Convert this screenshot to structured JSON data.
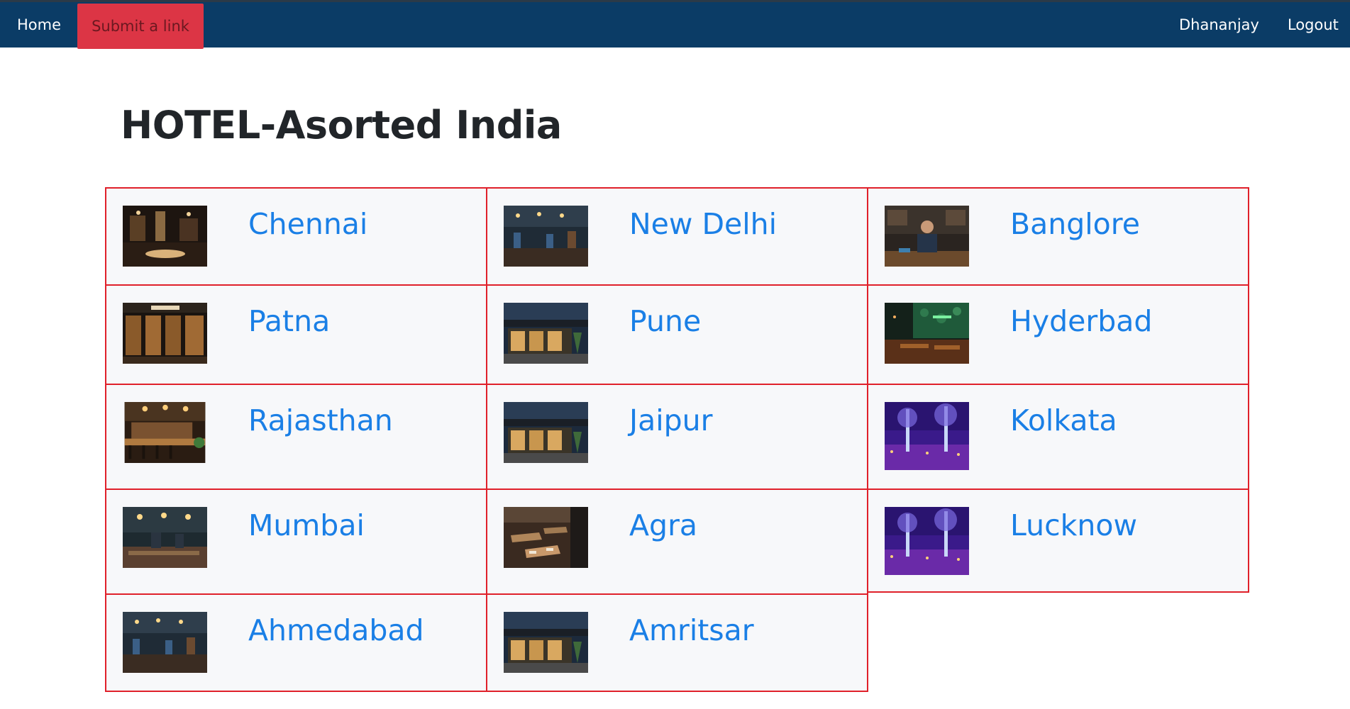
{
  "nav": {
    "home_label": "Home",
    "submit_label": "Submit a link",
    "user_label": "Dhananjay",
    "logout_label": "Logout"
  },
  "page": {
    "title": "HOTEL-Asorted India"
  },
  "colors": {
    "navbar": "#0b3c66",
    "submit_button": "#dc3545",
    "card_border": "#e0202a",
    "card_bg": "#f7f8fa",
    "link": "#1a7fe6"
  },
  "cities": [
    {
      "name": "Chennai",
      "thumb": "hotel-interior-photo"
    },
    {
      "name": "New Delhi",
      "thumb": "restaurant-photo"
    },
    {
      "name": "Banglore",
      "thumb": "chef-photo"
    },
    {
      "name": "Patna",
      "thumb": "restaurant-facade-photo"
    },
    {
      "name": "Pune",
      "thumb": "restaurant-exterior-photo"
    },
    {
      "name": "Hyderbad",
      "thumb": "green-wall-restaurant-photo"
    },
    {
      "name": "Rajasthan",
      "thumb": "bar-counter-photo"
    },
    {
      "name": "Jaipur",
      "thumb": "restaurant-exterior-photo"
    },
    {
      "name": "Kolkata",
      "thumb": "purple-lit-trees-photo"
    },
    {
      "name": "Mumbai",
      "thumb": "cafe-interior-photo"
    },
    {
      "name": "Agra",
      "thumb": "dining-tables-photo"
    },
    {
      "name": "Lucknow",
      "thumb": "purple-lit-trees-photo"
    },
    {
      "name": "Ahmedabad",
      "thumb": "restaurant-photo"
    },
    {
      "name": "Amritsar",
      "thumb": "restaurant-exterior-photo"
    }
  ]
}
